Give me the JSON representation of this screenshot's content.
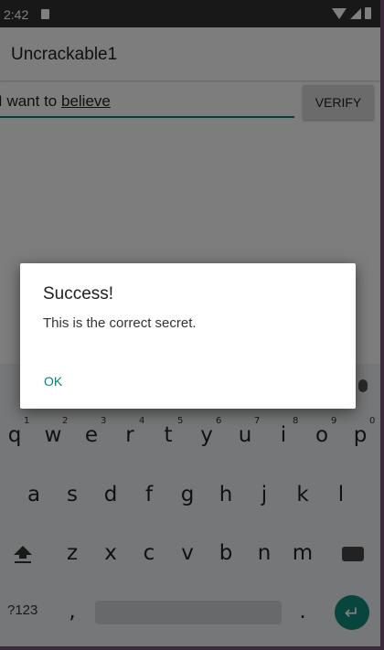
{
  "status_bar": {
    "time": "2:42"
  },
  "app_bar": {
    "title": "Uncrackable1"
  },
  "input": {
    "text_plain": "I want to ",
    "text_underlined": "believe"
  },
  "verify_button": {
    "label": "VERIFY"
  },
  "dialog": {
    "title": "Success!",
    "message": "This is the correct secret.",
    "ok_label": "OK"
  },
  "keyboard": {
    "row1": [
      "q",
      "w",
      "e",
      "r",
      "t",
      "y",
      "u",
      "i",
      "o",
      "p"
    ],
    "row1_hints": [
      "1",
      "2",
      "3",
      "4",
      "5",
      "6",
      "7",
      "8",
      "9",
      "0"
    ],
    "row2": [
      "a",
      "s",
      "d",
      "f",
      "g",
      "h",
      "j",
      "k",
      "l"
    ],
    "row3": [
      "z",
      "x",
      "c",
      "v",
      "b",
      "n",
      "m"
    ],
    "symbols_label": "?123",
    "comma": ",",
    "period": ".",
    "enter_glyph": "↵"
  },
  "colors": {
    "accent": "#008577",
    "enter_key": "#0f8a7a"
  }
}
